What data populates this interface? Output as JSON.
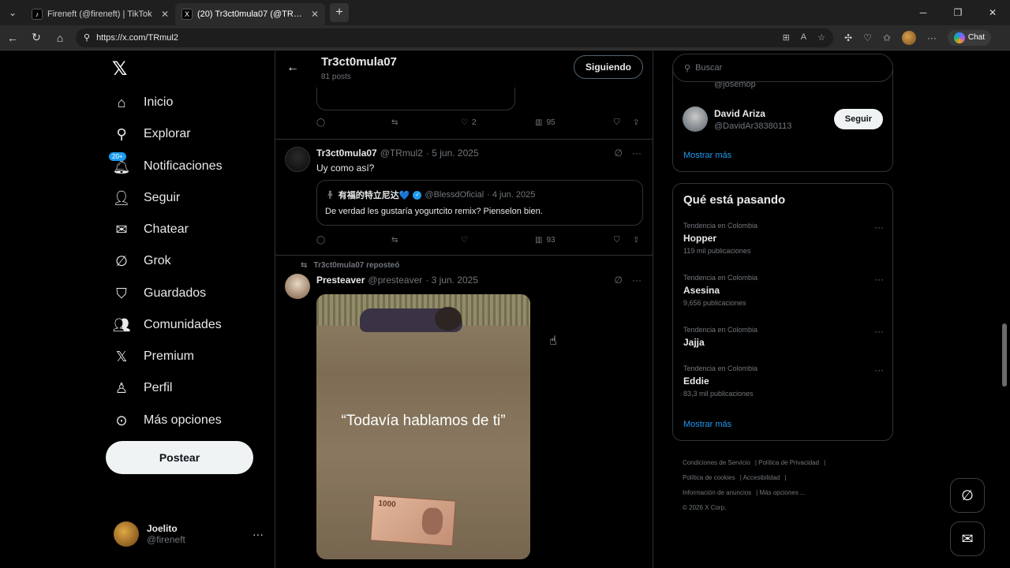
{
  "browser": {
    "tabs": [
      {
        "title": "Fireneft (@fireneft) | TikTok",
        "icon": "tiktok-icon"
      },
      {
        "title": "(20) Tr3ct0mula07 (@TRmul2) / X",
        "icon": "x-icon"
      }
    ],
    "url": "https://x.com/TRmul2",
    "chat_label": "Chat"
  },
  "leftnav": {
    "items": [
      {
        "label": "Inicio",
        "icon": "home-icon"
      },
      {
        "label": "Explorar",
        "icon": "search-icon"
      },
      {
        "label": "Notificaciones",
        "icon": "bell-icon",
        "badge": "20+"
      },
      {
        "label": "Seguir",
        "icon": "person-add-icon"
      },
      {
        "label": "Chatear",
        "icon": "mail-icon"
      },
      {
        "label": "Grok",
        "icon": "grok-icon"
      },
      {
        "label": "Guardados",
        "icon": "bookmark-icon"
      },
      {
        "label": "Comunidades",
        "icon": "communities-icon"
      },
      {
        "label": "Premium",
        "icon": "x-icon"
      },
      {
        "label": "Perfil",
        "icon": "person-icon"
      },
      {
        "label": "Más opciones",
        "icon": "more-circle-icon"
      }
    ],
    "post_button": "Postear",
    "account": {
      "name": "Joelito",
      "handle": "@fireneft"
    }
  },
  "profile_header": {
    "name": "Tr3ct0mula07",
    "posts": "81 posts",
    "follow_label": "Siguiendo"
  },
  "tweets": [
    {
      "actions": {
        "replies": "",
        "reposts": "",
        "likes": "2",
        "views": "95"
      }
    },
    {
      "author": "Tr3ct0mula07",
      "handle": "@TRmul2",
      "date": "· 5 jun. 2025",
      "text": "Uy como así?",
      "quote": {
        "author": "有福的特立尼达💙",
        "handle": "@BlessdOficial",
        "date": "· 4 jun. 2025",
        "text": "De verdad les gustaría yogurtcito remix? Pienselon bien."
      },
      "actions": {
        "replies": "",
        "reposts": "",
        "likes": "",
        "views": "93"
      }
    },
    {
      "repost_label": "Tr3ct0mula07 reposteó",
      "author": "Presteaver",
      "handle": "@presteaver",
      "date": "· 3 jun. 2025",
      "media_caption": "“Todavía hablamos de ti”",
      "bill_number": "1000"
    }
  ],
  "right": {
    "search_placeholder": "Buscar",
    "partial_handle": "@josemop",
    "who_to_follow": {
      "name": "David Ariza",
      "handle": "@DavidAr38380113",
      "button": "Seguir"
    },
    "show_more": "Mostrar más",
    "trends_title": "Qué está pasando",
    "trends": [
      {
        "context": "Tendencia en Colombia",
        "name": "Hopper",
        "count": "119 mil publicaciones"
      },
      {
        "context": "Tendencia en Colombia",
        "name": "Asesina",
        "count": "9,656 publicaciones"
      },
      {
        "context": "Tendencia en Colombia",
        "name": "Jajja",
        "count": ""
      },
      {
        "context": "Tendencia en Colombia",
        "name": "Eddie",
        "count": "83,3 mil publicaciones"
      }
    ],
    "trends_show_more": "Mostrar más",
    "footer": [
      "Condiciones de Servicio",
      "Política de Privacidad",
      "Política de cookies",
      "Accesibilidad",
      "Información de anuncios",
      "Más opciones ...",
      "© 2026 X Corp."
    ]
  }
}
